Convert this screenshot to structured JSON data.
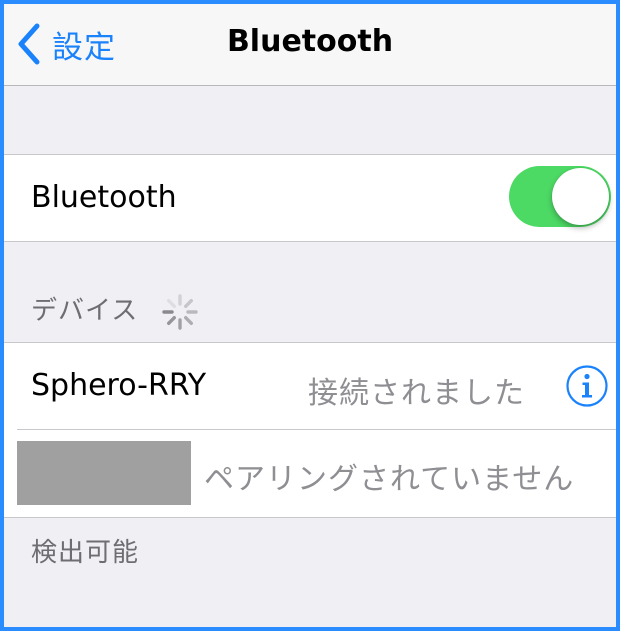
{
  "navbar": {
    "back_label": "設定",
    "title": "Bluetooth"
  },
  "bluetooth_toggle": {
    "label": "Bluetooth",
    "on": true,
    "color": "#4cd964"
  },
  "devices": {
    "header": "デバイス",
    "loading_icon": "spinner-icon",
    "items": [
      {
        "name": "Sphero-RRY",
        "status": "接続されました",
        "icon": "info-icon"
      },
      {
        "status": "ペアリングされていません"
      }
    ]
  },
  "discoverable": {
    "header": "検出可能"
  },
  "colors": {
    "accent": "#1a82fb",
    "switch_on": "#4cd964",
    "secondary_text": "#8e8e93"
  }
}
